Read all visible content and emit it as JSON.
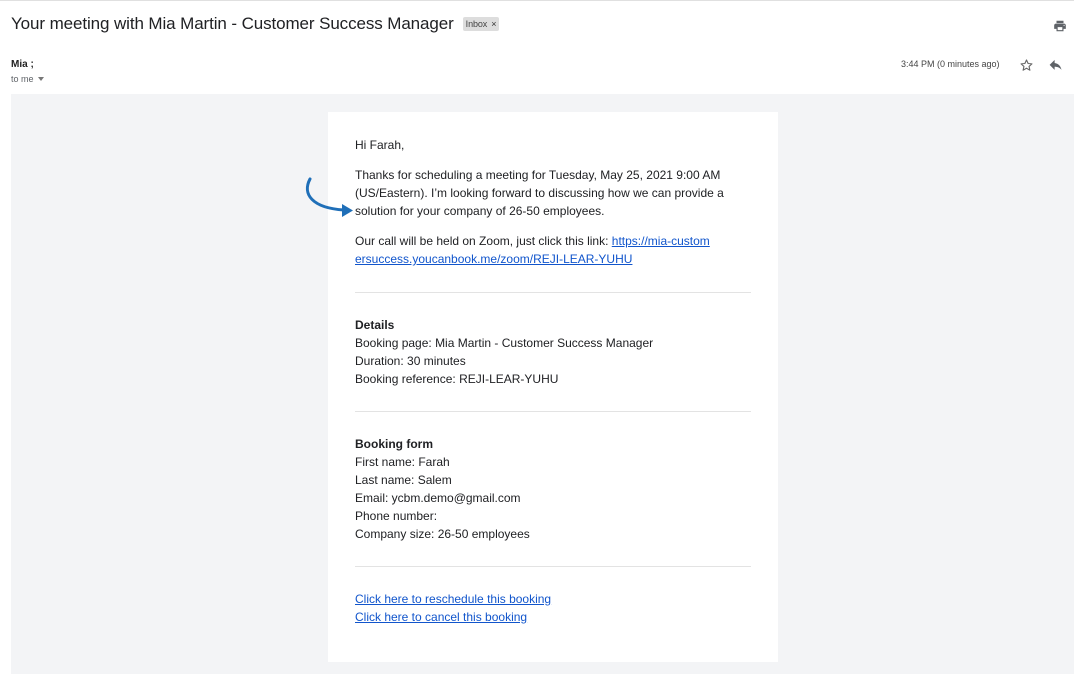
{
  "header": {
    "subject": "Your meeting with Mia Martin - Customer Success Manager",
    "badge_label": "Inbox",
    "badge_close": "×"
  },
  "message_meta": {
    "sender": "Mia ;",
    "recipient": "to me",
    "timestamp": "3:44 PM (0 minutes ago)"
  },
  "icons": {
    "print": "print-icon",
    "star": "star-icon",
    "reply": "reply-icon",
    "arrow": "annotation-arrow"
  },
  "colors": {
    "link": "#1155cc",
    "arrow": "#1f6fb8",
    "email_background": "#f3f4f6"
  },
  "body": {
    "greeting": "Hi Farah,",
    "intro": "Thanks for scheduling a meeting for Tuesday, May 25, 2021 9:00 AM (US/Eastern). I’m looking forward to discussing how we can provide a solution for your company of 26-50 employees.",
    "call_text": "Our call will be held on Zoom, just click this link: ",
    "call_link": "https://mia-customersuccess.youcanbook.me/zoom/REJI-LEAR-YUHU",
    "details": {
      "heading": "Details",
      "booking_page": "Booking page: Mia Martin - Customer Success Manager",
      "duration": "Duration: 30 minutes",
      "reference": "Booking reference: REJI-LEAR-YUHU"
    },
    "form": {
      "heading": "Booking form",
      "first_name": "First name: Farah",
      "last_name": "Last name: Salem",
      "email": "Email: ycbm.demo@gmail.com",
      "phone": "Phone number:",
      "company_size": "Company size: 26-50 employees"
    },
    "reschedule_link": "Click here to reschedule this booking",
    "cancel_link": "Click here to cancel this booking"
  }
}
